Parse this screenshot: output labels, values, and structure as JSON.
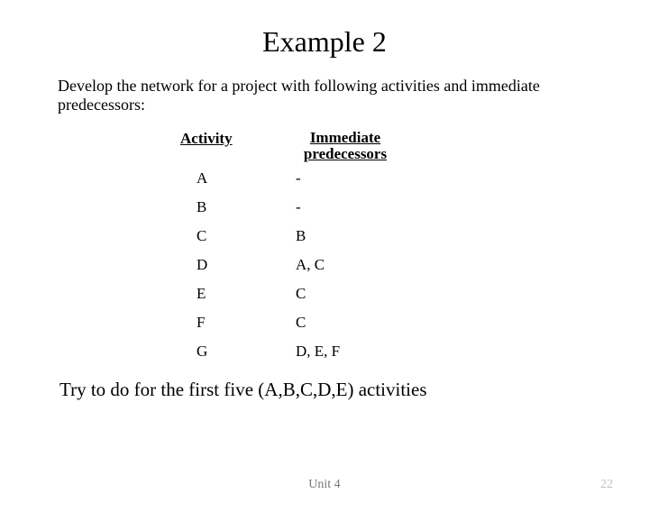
{
  "title": "Example 2",
  "intro": "Develop the network for a project with following activities and immediate predecessors:",
  "table": {
    "headers": {
      "activity": "Activity",
      "pred": "Immediate\npredecessors"
    },
    "rows": [
      {
        "activity": "A",
        "pred": "-"
      },
      {
        "activity": "B",
        "pred": "-"
      },
      {
        "activity": "C",
        "pred": "B"
      },
      {
        "activity": "D",
        "pred": "A, C"
      },
      {
        "activity": "E",
        "pred": "C"
      },
      {
        "activity": "F",
        "pred": "C"
      },
      {
        "activity": "G",
        "pred": "D, E, F"
      }
    ]
  },
  "closing": "Try to do for the first five (A,B,C,D,E) activities",
  "footer": {
    "center": "Unit 4",
    "page": "22"
  }
}
